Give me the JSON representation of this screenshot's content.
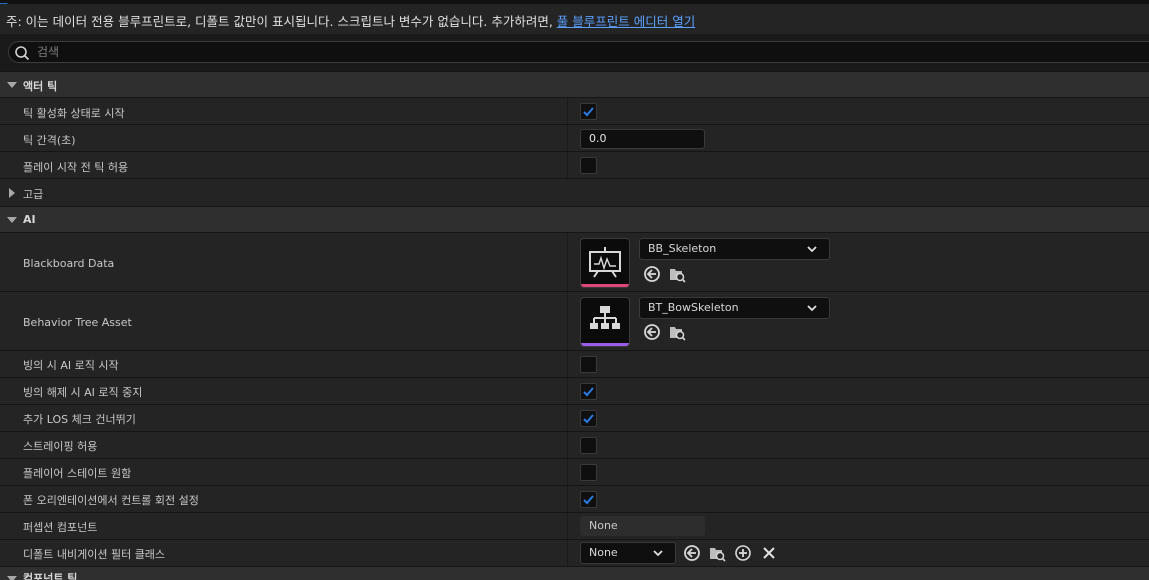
{
  "notice": {
    "text": "주: 이는 데이터 전용 블루프린트로, 디폴트 값만이 표시됩니다. 스크립트나 변수가 없습니다. 추가하려면, ",
    "link": "풀 블루프린트 에디터 열기"
  },
  "search": {
    "placeholder": "검색",
    "value": ""
  },
  "sections": {
    "actor_tick": {
      "label": "액터 틱"
    },
    "ai": {
      "label": "AI"
    },
    "component_tick": {
      "label": "컴포넌트 틱"
    }
  },
  "actor_tick": {
    "start_with_tick_enabled": {
      "label": "틱 활성화 상태로 시작",
      "checked": true
    },
    "tick_interval": {
      "label": "틱 간격(초)",
      "value": "0.0"
    },
    "allow_tick_before_begin_play": {
      "label": "플레이 시작 전 틱 허용",
      "checked": false
    },
    "advanced": {
      "label": "고급"
    }
  },
  "ai": {
    "blackboard": {
      "label": "Blackboard Data",
      "asset": "BB_Skeleton",
      "accent": "#e0457a"
    },
    "behavior_tree": {
      "label": "Behavior Tree Asset",
      "asset": "BT_BowSkeleton",
      "accent": "#9b5de5"
    },
    "start_logic_on_possess": {
      "label": "빙의 시 AI 로직 시작",
      "checked": false
    },
    "stop_logic_on_unpossess": {
      "label": "빙의 해제 시 AI 로직 중지",
      "checked": true
    },
    "skip_extra_los_checks": {
      "label": "추가 LOS 체크 건너뛰기",
      "checked": true
    },
    "allow_strafe": {
      "label": "스트레이핑 허용",
      "checked": false
    },
    "wants_player_state": {
      "label": "플레이어 스테이트 원함",
      "checked": false
    },
    "set_control_rotation": {
      "label": "폰 오리엔테이션에서 컨트롤 회전 설정",
      "checked": true
    },
    "perception_component": {
      "label": "퍼셉션 컴포넌트",
      "value": "None"
    },
    "default_nav_filter": {
      "label": "디폴트 내비게이션 필터 클래스",
      "value": "None"
    }
  },
  "colors": {
    "accent_check": "#1f6fd1",
    "link": "#5aa0ff"
  },
  "icons": [
    "search-icon",
    "checkmark-icon",
    "chevron-down-icon",
    "use-selected-icon",
    "browse-icon",
    "add-icon",
    "clear-icon",
    "blackboard-icon",
    "behavior-tree-icon"
  ]
}
